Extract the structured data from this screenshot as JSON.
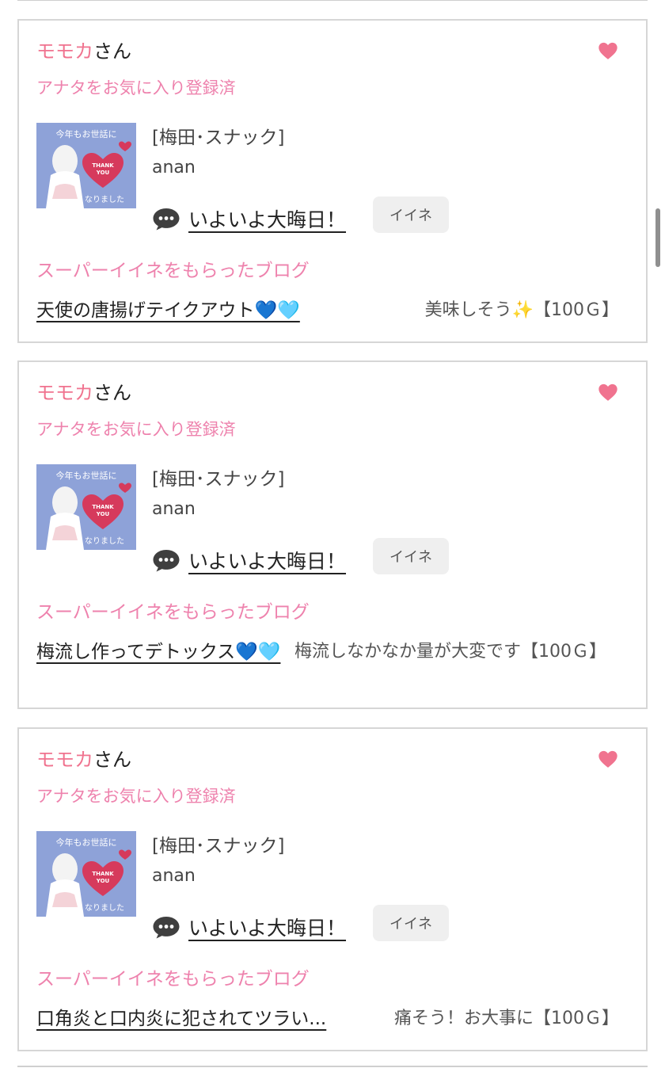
{
  "user_suffix": "さん",
  "notifications": [
    {
      "user_name": "モモカ",
      "favorite_status": "アナタをお気に入り登録済",
      "category": "[梅田･スナック]",
      "author": "anan",
      "post_title": "いよいよ大晦日！",
      "like_button": "イイネ",
      "section_label": "スーパーイイネをもらったブログ",
      "blog_title": "天使の唐揚げテイクアウト💙🩵",
      "super_comment": "美味しそう✨【100Ｇ】"
    },
    {
      "user_name": "モモカ",
      "favorite_status": "アナタをお気に入り登録済",
      "category": "[梅田･スナック]",
      "author": "anan",
      "post_title": "いよいよ大晦日！",
      "like_button": "イイネ",
      "section_label": "スーパーイイネをもらったブログ",
      "blog_title": "梅流し作ってデトックス💙🩵",
      "super_comment": "梅流しなかなか量が大変です【100Ｇ】"
    },
    {
      "user_name": "モモカ",
      "favorite_status": "アナタをお気に入り登録済",
      "category": "[梅田･スナック]",
      "author": "anan",
      "post_title": "いよいよ大晦日！",
      "like_button": "イイネ",
      "section_label": "スーパーイイネをもらったブログ",
      "blog_title": "口角炎と口内炎に犯されてツラい...",
      "super_comment": "痛そう！お大事に【100Ｇ】"
    }
  ],
  "thumbnail": {
    "top_text": "今年もお世話に",
    "heart_text_1": "THANK",
    "heart_text_2": "YOU",
    "bottom_text": "なりました"
  },
  "colors": {
    "accent_pink": "#ee82ad",
    "heart_pink": "#f0738f",
    "thumb_bg": "#8ea2d8",
    "thumb_heart": "#d63a5c"
  },
  "icons": {
    "favorite": "heart-icon",
    "comment": "speech-bubble-icon"
  }
}
